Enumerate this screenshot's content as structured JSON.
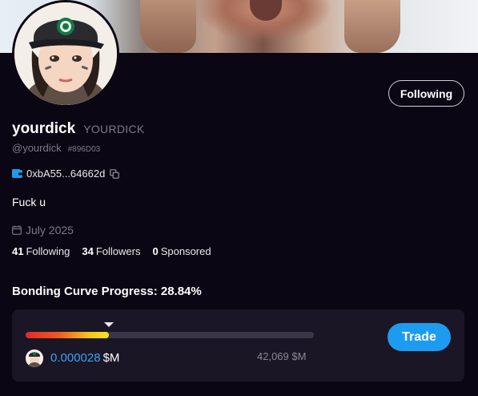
{
  "profile": {
    "display_name": "yourdick",
    "ticker": "YOURDICK",
    "handle": "@yourdick",
    "hex_code": "#896D03",
    "wallet_address": "0xbA55...64662d",
    "bio": "Fuck u",
    "joined": "July 2025"
  },
  "header": {
    "following_button_label": "Following"
  },
  "stats": {
    "following_count": "41",
    "following_label": "Following",
    "followers_count": "34",
    "followers_label": "Followers",
    "sponsored_count": "0",
    "sponsored_label": "Sponsored"
  },
  "bonding_curve": {
    "title": "Bonding Curve Progress: 28.84%",
    "progress_fraction": 0.2884,
    "price": "0.000028",
    "price_unit": "$M",
    "market_cap_target": "42,069 $M",
    "trade_button_label": "Trade"
  },
  "colors": {
    "background": "#0b0613",
    "card": "#1b1625",
    "accent_blue": "#1d9bf0",
    "price_blue": "#3aa1f2",
    "muted_text": "#7d7a86"
  },
  "icons": {
    "wallet": "wallet-icon",
    "copy": "copy-icon",
    "calendar": "calendar-icon",
    "progress_marker": "triangle-down-icon"
  }
}
